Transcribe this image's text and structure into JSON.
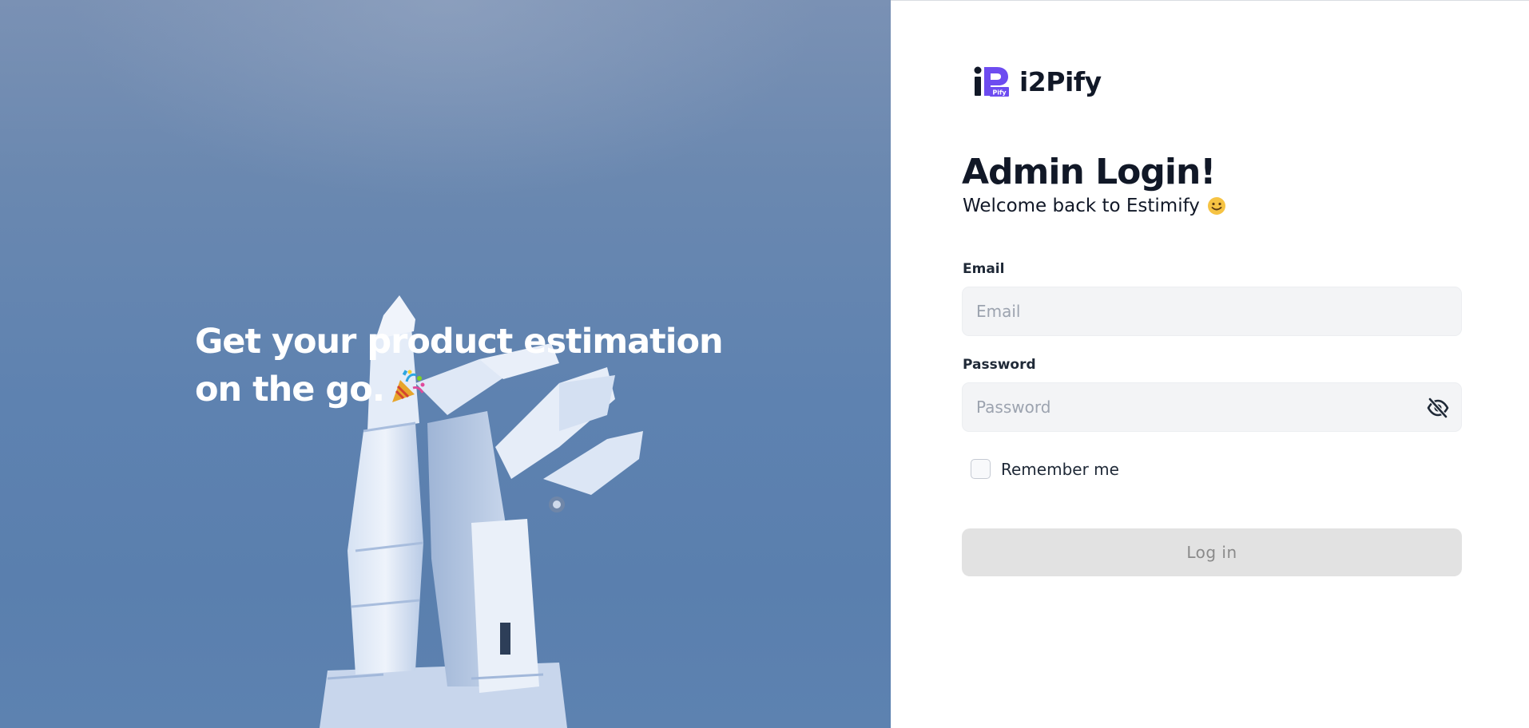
{
  "hero": {
    "line1": "Get your product estimation",
    "line2": "on the go.",
    "icon": "party-popper-icon"
  },
  "brand": {
    "name": "i2Pify",
    "logo_badge": "Pify",
    "logo_color": "#6d4cf0"
  },
  "login": {
    "title": "Admin Login!",
    "subtitle": "Welcome back to Estimify",
    "subtitle_icon": "smiling-face-icon",
    "email_label": "Email",
    "email_placeholder": "Email",
    "email_value": "",
    "password_label": "Password",
    "password_placeholder": "Password",
    "password_value": "",
    "password_toggle_icon": "eye-off-icon",
    "remember_label": "Remember me",
    "remember_checked": false,
    "submit_label": "Log in"
  },
  "colors": {
    "hero_blue": "#5e82b0",
    "input_bg": "#f3f4f6",
    "button_disabled_bg": "#e2e2e2",
    "text_dark": "#111827"
  }
}
